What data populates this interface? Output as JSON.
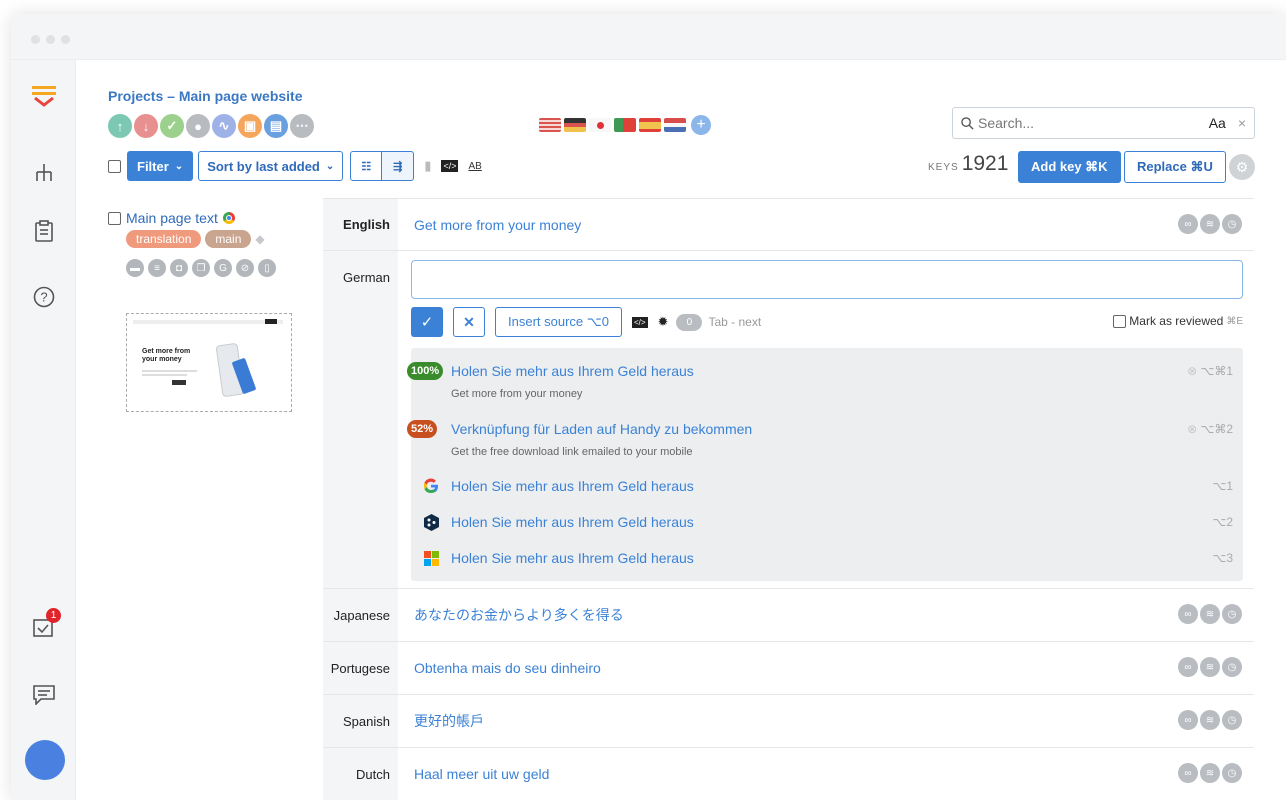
{
  "project": {
    "title": "Projects – Main page website",
    "status_icons": [
      {
        "icon": "arrow-up-icon",
        "color": "#7cc8b3"
      },
      {
        "icon": "arrow-down-icon",
        "color": "#e88f8f"
      },
      {
        "icon": "check-icon",
        "color": "#9bd18c"
      },
      {
        "icon": "user-icon",
        "color": "#b8bcc1"
      },
      {
        "icon": "chart-icon",
        "color": "#9eb2e8"
      },
      {
        "icon": "camera-icon",
        "color": "#f4a65d"
      },
      {
        "icon": "book-icon",
        "color": "#6a9fe0"
      },
      {
        "icon": "more-icon",
        "color": "#b8bcc1"
      }
    ],
    "flags": [
      "us",
      "de",
      "jp",
      "pt",
      "es",
      "nl"
    ]
  },
  "search": {
    "placeholder": "Search...",
    "case_label": "Aa",
    "clear": "×"
  },
  "toolbar": {
    "filter_label": "Filter",
    "sort_label": "Sort by last added",
    "keys_label": "KEYS",
    "keys_count": "1921",
    "add_key_label": "Add key ⌘K",
    "replace_label": "Replace ⌘U"
  },
  "key": {
    "name": "Main page text",
    "tags": [
      {
        "label": "translation",
        "color": "#f09a7d"
      },
      {
        "label": "main",
        "color": "#c9a48e"
      }
    ],
    "screenshot_heading": "Get more from your money"
  },
  "translations": {
    "english": {
      "lang": "English",
      "value": "Get more from your money"
    },
    "german": {
      "lang": "German",
      "insert_source": "Insert source ⌥0",
      "counter": "0",
      "tab_next": "Tab - next",
      "mark_reviewed": "Mark as reviewed",
      "mark_reviewed_kbd": "⌘E",
      "suggestions": [
        {
          "badge": "100%",
          "badge_color": "#3a8b2c",
          "text": "Holen Sie mehr aus Ihrem Geld heraus",
          "source": "Get more from your money",
          "shortcut": "⌥⌘1"
        },
        {
          "badge": "52%",
          "badge_color": "#c8501e",
          "text": "Verknüpfung für Laden auf Handy zu bekommen",
          "source": "Get the free download link emailed to your mobile",
          "shortcut": "⌥⌘2"
        }
      ],
      "machine": [
        {
          "engine": "google-icon",
          "text": "Holen Sie mehr aus Ihrem Geld heraus",
          "shortcut": "⌥1"
        },
        {
          "engine": "deepl-icon",
          "text": "Holen Sie mehr aus Ihrem Geld heraus",
          "shortcut": "⌥2"
        },
        {
          "engine": "microsoft-icon",
          "text": "Holen Sie mehr aus Ihrem Geld heraus",
          "shortcut": "⌥3"
        }
      ]
    },
    "japanese": {
      "lang": "Japanese",
      "value": "あなたのお金からより多くを得る"
    },
    "portuguese": {
      "lang": "Portugese",
      "value": "Obtenha mais do seu dinheiro"
    },
    "spanish": {
      "lang": "Spanish",
      "value": "更好的帳戶"
    },
    "dutch": {
      "lang": "Dutch",
      "value": "Haal meer uit uw geld"
    }
  },
  "sidebar": {
    "notification_count": "1"
  }
}
